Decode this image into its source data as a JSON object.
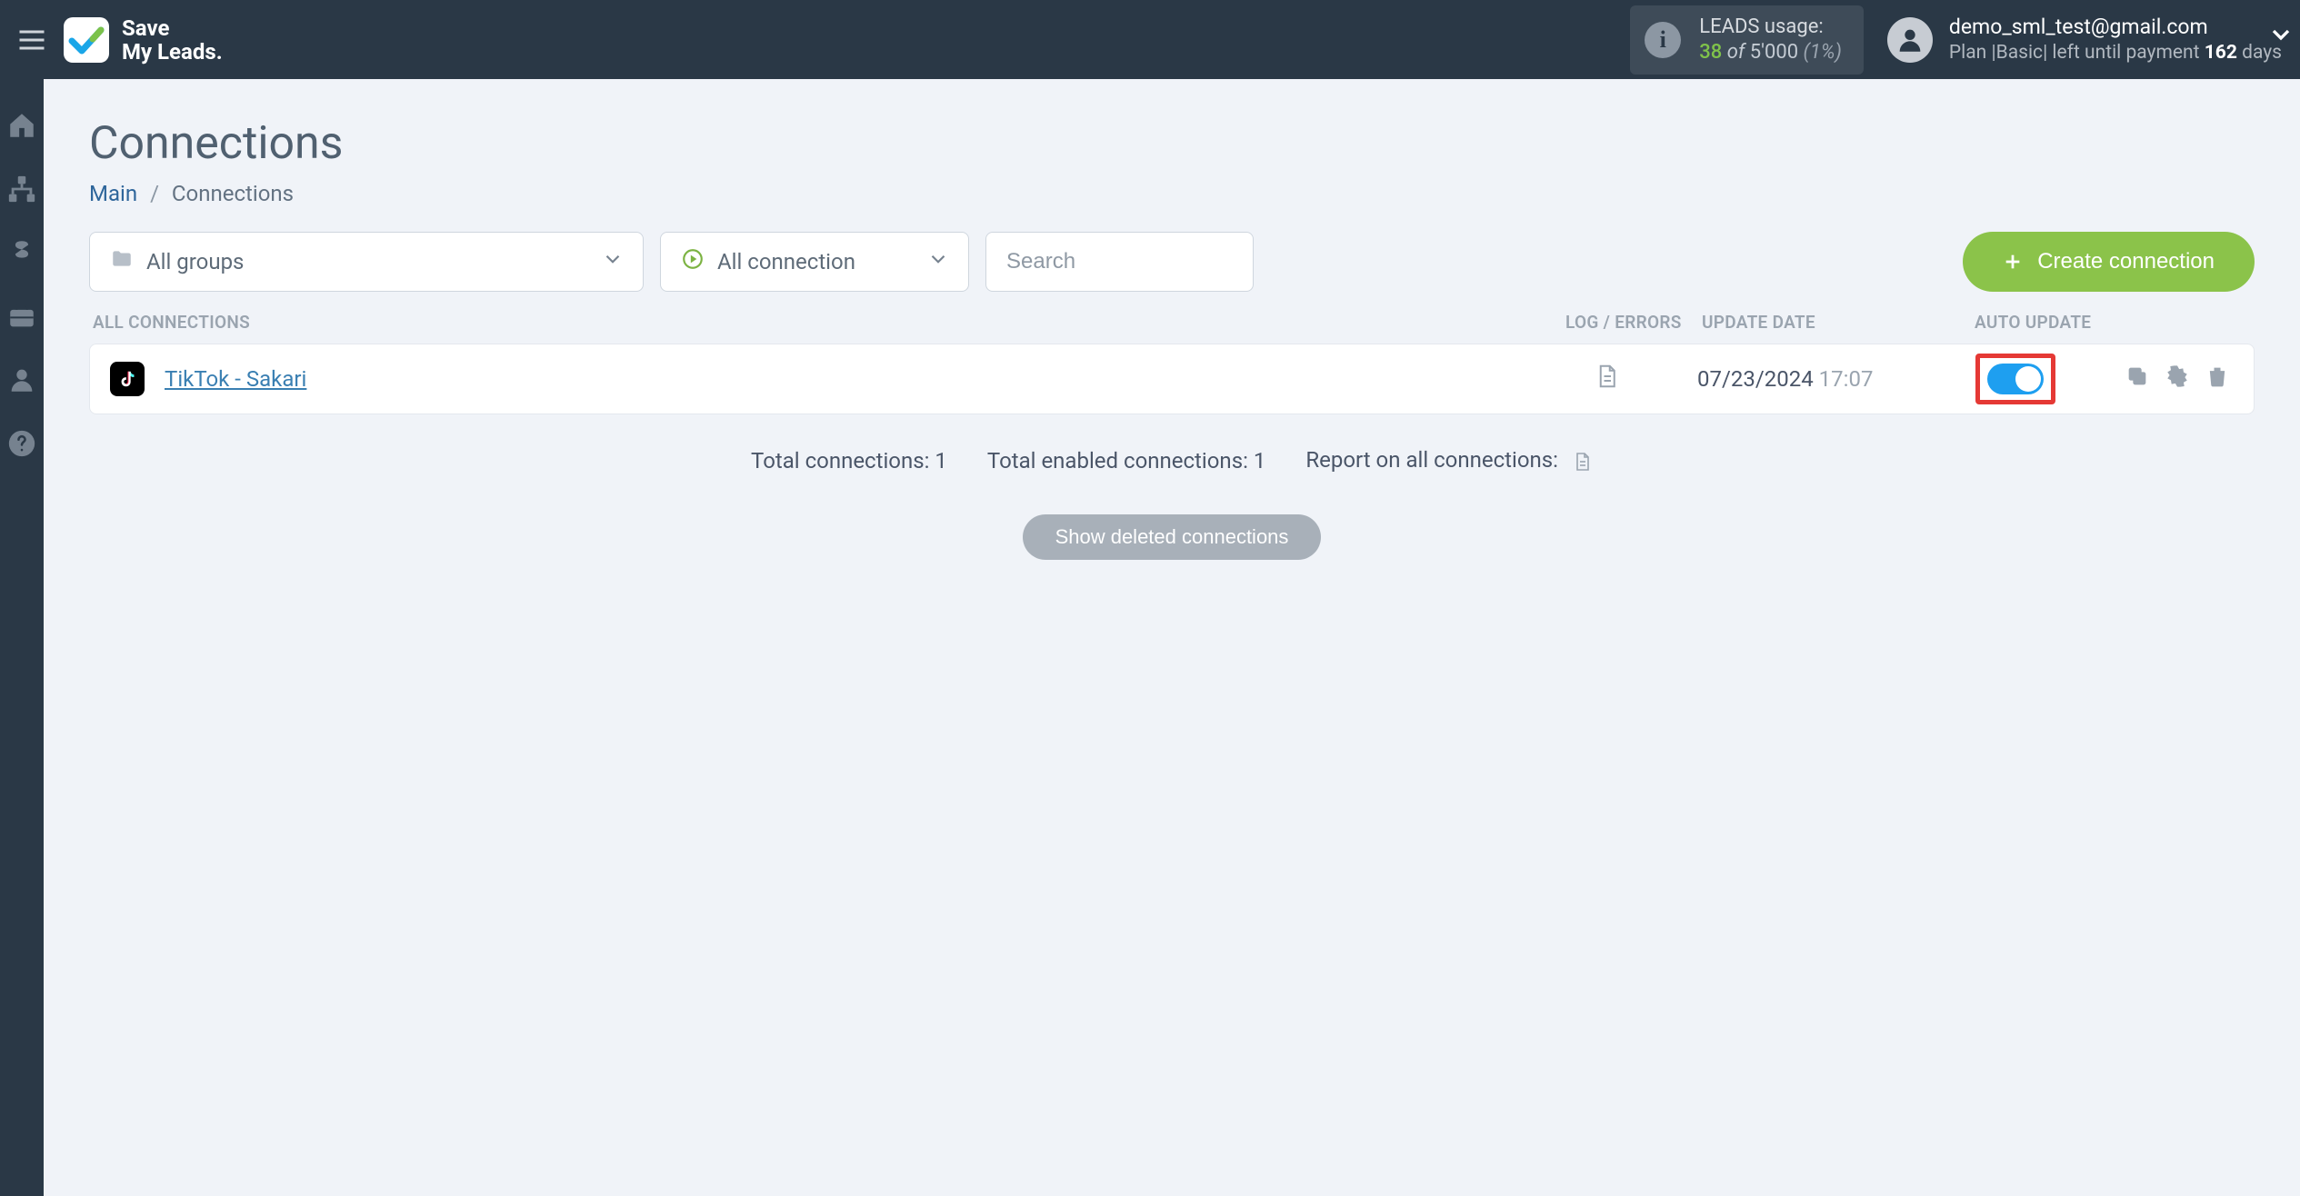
{
  "brand": {
    "line1": "Save",
    "line2": "My Leads."
  },
  "header": {
    "leads_label": "LEADS usage:",
    "leads_used": "38",
    "leads_of": "of",
    "leads_limit": "5'000",
    "leads_pct": "(1%)",
    "account_email": "demo_sml_test@gmail.com",
    "plan_prefix": "Plan |",
    "plan_name": "Basic",
    "plan_mid": "| left until payment",
    "plan_days": "162",
    "plan_days_suffix": "days"
  },
  "page": {
    "title": "Connections",
    "breadcrumb_main": "Main",
    "breadcrumb_sep": "/",
    "breadcrumb_current": "Connections"
  },
  "filters": {
    "groups_label": "All groups",
    "status_label": "All connection",
    "search_placeholder": "Search",
    "create_label": "Create connection"
  },
  "table": {
    "head_all": "ALL CONNECTIONS",
    "head_log": "LOG / ERRORS",
    "head_date": "UPDATE DATE",
    "head_auto": "AUTO UPDATE",
    "rows": [
      {
        "name": "TikTok - Sakari",
        "date": "07/23/2024",
        "time": "17:07",
        "auto": true
      }
    ]
  },
  "summary": {
    "total_label": "Total connections:",
    "total_value": "1",
    "enabled_label": "Total enabled connections:",
    "enabled_value": "1",
    "report_label": "Report on all connections:"
  },
  "show_deleted": "Show deleted connections"
}
